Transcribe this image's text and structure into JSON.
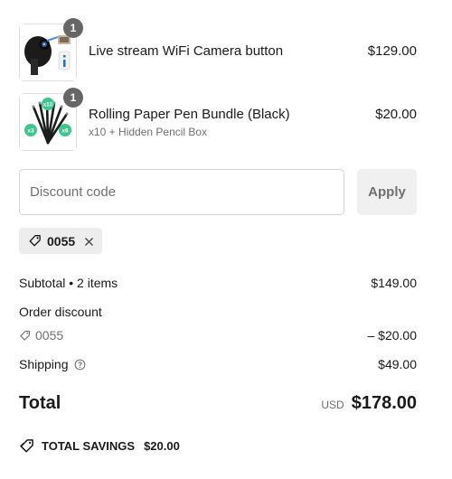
{
  "line_items": [
    {
      "name": "Live stream WiFi Camera button",
      "variant": "",
      "price": "$129.00",
      "quantity": "1",
      "image_icon": "camera-product-image"
    },
    {
      "name": "Rolling Paper Pen Bundle (Black)",
      "variant": "x10 + Hidden Pencil Box",
      "price": "$20.00",
      "quantity": "1",
      "image_icon": "pen-bundle-product-image",
      "image_badges": [
        "x10",
        "x3",
        "x6"
      ]
    }
  ],
  "discount": {
    "placeholder": "Discount code",
    "value": "",
    "apply_label": "Apply",
    "applied_code": "0055",
    "tag_icon": "tag-icon",
    "remove_icon": "close-icon"
  },
  "summary": {
    "subtotal_label": "Subtotal • 2 items",
    "subtotal_value": "$149.00",
    "order_discount_label": "Order discount",
    "order_discount_code": "0055",
    "order_discount_value": "– $20.00",
    "shipping_label": "Shipping",
    "shipping_info_icon": "help-circle-icon",
    "shipping_value": "$49.00",
    "total_label": "Total",
    "currency": "USD",
    "total_value": "$178.00"
  },
  "savings": {
    "label": "TOTAL SAVINGS",
    "value": "$20.00",
    "icon": "tag-icon"
  },
  "colors": {
    "text": "#1a1a1a",
    "muted": "#707070",
    "badge": "#666666",
    "chip_bg": "#ededed",
    "button_bg": "#f0f0f0",
    "border": "#d4d4d4",
    "product_green": "#3cc88c"
  }
}
